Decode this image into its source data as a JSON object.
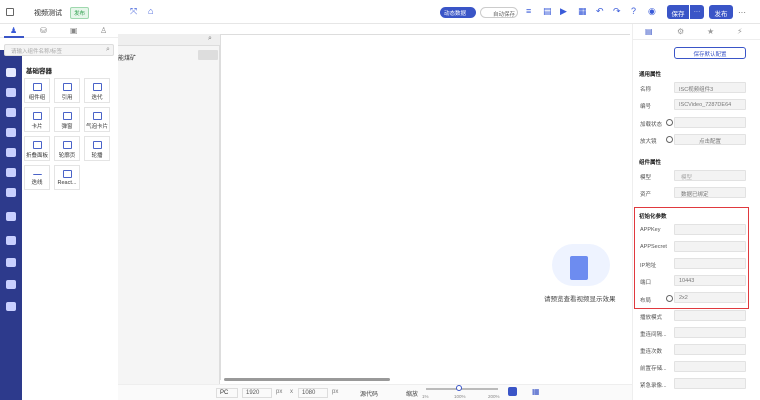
{
  "header": {
    "title": "视频测试",
    "badge": "发布",
    "toggle1": "动态数据",
    "toggle2": "自动保存",
    "save": "保存",
    "more": "···",
    "publish": "发布",
    "more2": "···"
  },
  "left": {
    "search_placeholder": "请输入组件名称/标签",
    "section": "基础容器",
    "items": [
      "组件组",
      "引用",
      "迭代",
      "卡片",
      "弹窗",
      "气泡卡片",
      "折叠面板",
      "轮廓页",
      "轮播",
      "迭线",
      "React..."
    ]
  },
  "canvas": {
    "stub": "能煤矿",
    "empty": "请预览查看视频显示效果"
  },
  "right": {
    "save_default": "保存默认配置",
    "s1": "通用属性",
    "name_l": "名称",
    "name_v": "ISC视频组件3",
    "code_l": "编号",
    "code_v": "ISCVideo_7287DE64",
    "load_l": "加载状态",
    "zoom_l": "放大镜",
    "zoom_btn": "点击配置",
    "s2": "组件属性",
    "model_l": "模型",
    "model_v": "模型",
    "res_l": "资产",
    "res_v": "数据已绑定",
    "s3": "初始化参数",
    "appkey_l": "APPKey",
    "appsecret_l": "APPSecret",
    "ip_l": "IP地址",
    "port_l": "端口",
    "port_v": "10443",
    "layout_l": "布局",
    "layout_v": "2x2",
    "play_l": "播放模式",
    "retry_l": "重连间隔...",
    "retrycnt_l": "重连次数",
    "frontstore_l": "前置存储...",
    "emergency_l": "紧急录像..."
  },
  "bottom": {
    "device": "PC",
    "w": "1920",
    "h": "1080",
    "px": "px",
    "x": "x",
    "source": "源代码",
    "zoom": "缩放",
    "z1": "1%",
    "z2": "100%",
    "z3": "200%"
  }
}
